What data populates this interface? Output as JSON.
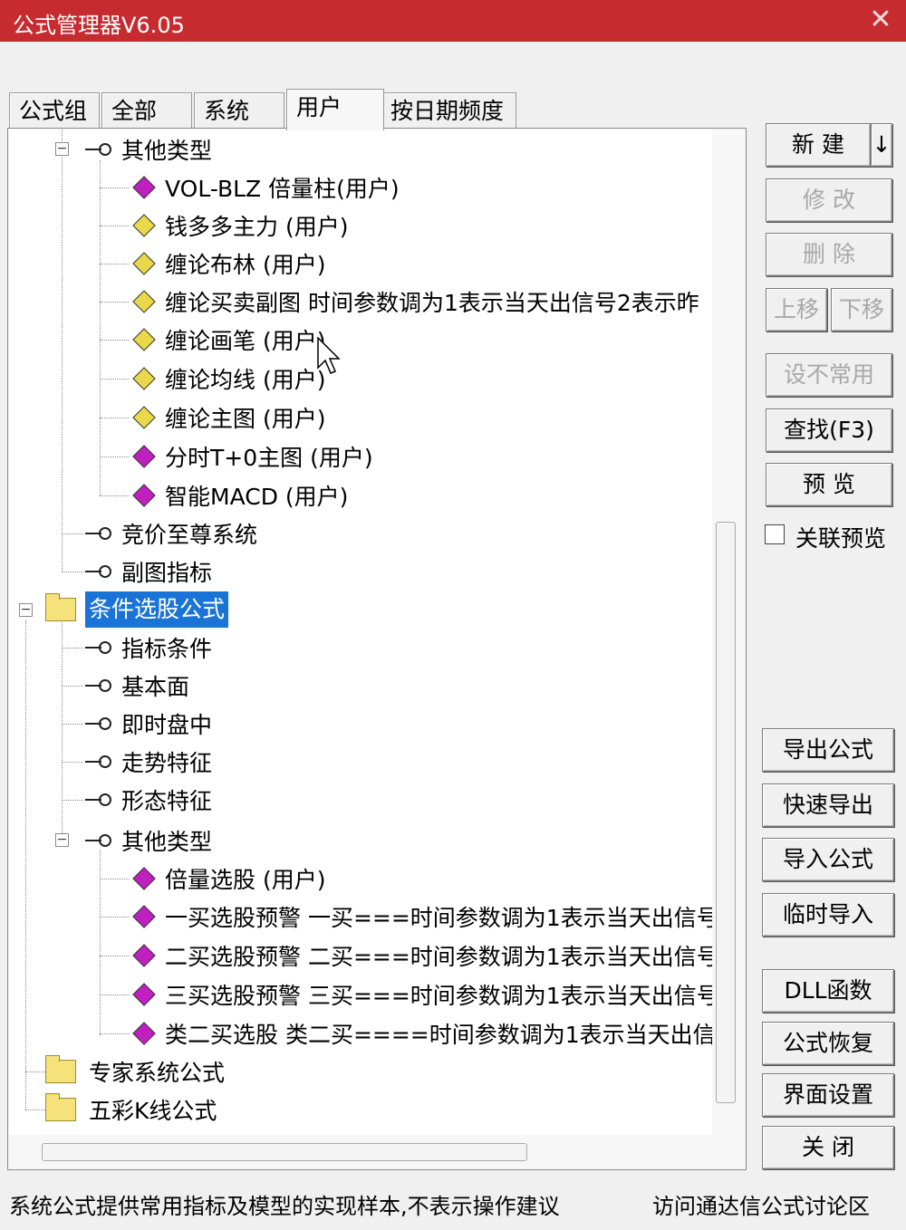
{
  "window": {
    "title": "公式管理器V6.05"
  },
  "tabs": [
    {
      "label": "公式组",
      "active": false
    },
    {
      "label": "全部",
      "active": false
    },
    {
      "label": "系统",
      "active": false
    },
    {
      "label": "用户",
      "active": true
    },
    {
      "label": "按日期频度",
      "active": false
    }
  ],
  "tree": {
    "nodes": [
      {
        "label": "其他类型"
      },
      {
        "label": "VOL-BLZ  倍量柱(用户)"
      },
      {
        "label": "钱多多主力  (用户)"
      },
      {
        "label": "缠论布林  (用户)"
      },
      {
        "label": "缠论买卖副图  时间参数调为1表示当天出信号2表示昨"
      },
      {
        "label": "缠论画笔  (用户)"
      },
      {
        "label": "缠论均线  (用户)"
      },
      {
        "label": "缠论主图  (用户)"
      },
      {
        "label": "分时T+0主图  (用户)"
      },
      {
        "label": "智能MACD  (用户)"
      },
      {
        "label": "竞价至尊系统"
      },
      {
        "label": "副图指标"
      },
      {
        "label": "条件选股公式"
      },
      {
        "label": "指标条件"
      },
      {
        "label": "基本面"
      },
      {
        "label": "即时盘中"
      },
      {
        "label": "走势特征"
      },
      {
        "label": "形态特征"
      },
      {
        "label": "其他类型"
      },
      {
        "label": "倍量选股  (用户)"
      },
      {
        "label": "一买选股预警  一买===时间参数调为1表示当天出信号"
      },
      {
        "label": "二买选股预警  二买===时间参数调为1表示当天出信号"
      },
      {
        "label": "三买选股预警  三买===时间参数调为1表示当天出信号"
      },
      {
        "label": "类二买选股  类二买====时间参数调为1表示当天出信"
      },
      {
        "label": "专家系统公式"
      },
      {
        "label": "五彩K线公式"
      }
    ]
  },
  "buttons": {
    "new": "新 建",
    "new_arrow": "↓",
    "modify": "修 改",
    "delete": "删 除",
    "move_up": "上移",
    "move_down": "下移",
    "set_uncommon": "设不常用",
    "find": "查找(F3)",
    "preview": "预 览",
    "export": "导出公式",
    "quick_export": "快速导出",
    "import": "导入公式",
    "temp_import": "临时导入",
    "dll": "DLL函数",
    "restore": "公式恢复",
    "ui_settings": "界面设置",
    "close": "关 闭"
  },
  "linked_preview": {
    "label": "关联预览",
    "checked": false
  },
  "status": {
    "left": "系统公式提供常用指标及模型的实现样本,不表示操作建议",
    "right": "访问通达信公式讨论区"
  },
  "colors": {
    "titlebar": "#c62b2f",
    "selection": "#1a74d8",
    "purple_gem": "#c020c0",
    "yellow_gem": "#e8d84a"
  }
}
